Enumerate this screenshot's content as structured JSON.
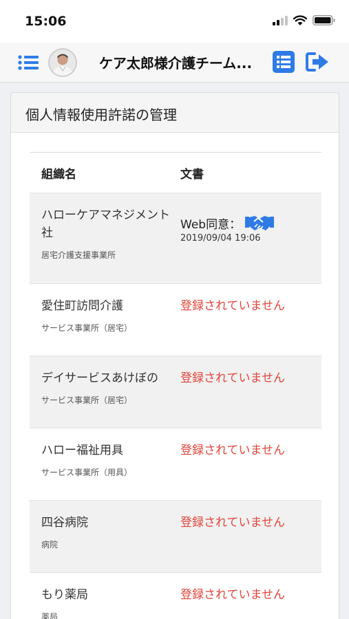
{
  "status_bar": {
    "time": "15:06"
  },
  "header": {
    "title": "ケア太郎様介護チーム..."
  },
  "colors": {
    "accent": "#2f7be6",
    "danger": "#e0453a"
  },
  "card": {
    "title": "個人情報使用許諾の管理",
    "table": {
      "col_org": "組織名",
      "col_doc": "文書",
      "rows": [
        {
          "org_name": "ハローケアマネジメント社",
          "org_type": "居宅介護支援事業所",
          "doc_label": "Web同意：",
          "doc_date": "2019/09/04 19:06",
          "icon": "handshake-icon"
        },
        {
          "org_name": "愛住町訪問介護",
          "org_type": "サービス事業所（居宅）",
          "doc_status": "登録されていません"
        },
        {
          "org_name": "デイサービスあけぼの",
          "org_type": "サービス事業所（居宅）",
          "doc_status": "登録されていません"
        },
        {
          "org_name": "ハロー福祉用具",
          "org_type": "サービス事業所（用具）",
          "doc_status": "登録されていません"
        },
        {
          "org_name": "四谷病院",
          "org_type": "病院",
          "doc_status": "登録されていません"
        },
        {
          "org_name": "もり薬局",
          "org_type": "薬局",
          "doc_status": "登録されていません"
        }
      ]
    }
  }
}
